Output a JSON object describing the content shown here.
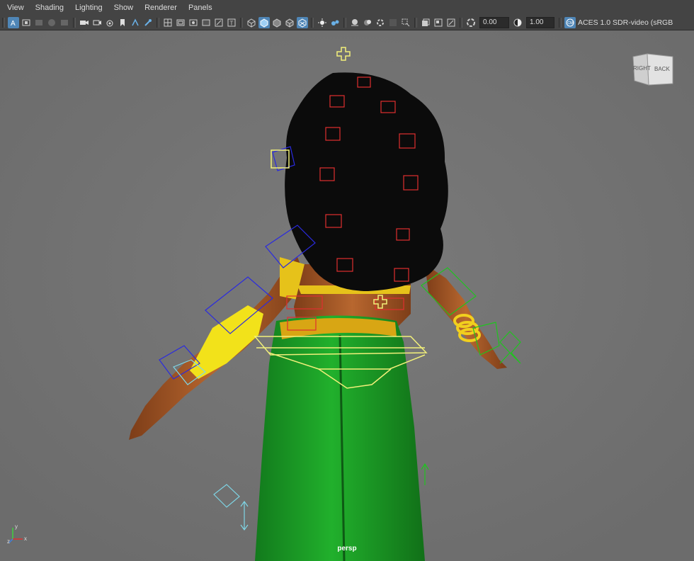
{
  "menu": {
    "view": "View",
    "shading": "Shading",
    "lighting": "Lighting",
    "show": "Show",
    "renderer": "Renderer",
    "panels": "Panels"
  },
  "toolbar": {
    "exposure_value": "0.00",
    "gamma_value": "1.00",
    "color_space_badge": "CM",
    "color_space_label": "ACES 1.0 SDR-video (sRGB",
    "accent_color": "#4f86b7",
    "icons": [
      "select-camera-icon",
      "camera-attributes-icon",
      "bookmark-icon",
      "image-plane-icon",
      "grid-icon",
      "film-gate-icon",
      "resolution-gate-icon",
      "gate-mask-icon",
      "field-chart-icon",
      "safe-action-icon",
      "safe-title-icon",
      "wireframe-icon",
      "smooth-shade-icon",
      "default-material-icon",
      "shaded-wireframe-icon",
      "textured-icon",
      "use-all-lights-icon",
      "shadows-icon",
      "screen-space-ao-icon",
      "motion-blur-icon",
      "multisample-aa-icon",
      "depth-of-field-icon",
      "isolate-select-icon",
      "xray-icon",
      "xray-active-icon",
      "xray-joints-icon",
      "backface-culling-icon",
      "exposure-icon",
      "gamma-icon",
      "color-management-icon"
    ]
  },
  "viewport": {
    "camera": "persp",
    "viewcube": {
      "right": "RIGHT",
      "back": "BACK"
    },
    "axis": {
      "y": "y",
      "x": "x",
      "z": "z"
    },
    "colors": {
      "background": "#777777",
      "hair": "#0b0b0b",
      "pants": "#1fa32a",
      "skin": "#a65a2a",
      "gold": "#e6c21a",
      "ctrl_red": "#e03030",
      "ctrl_blue": "#2a2ae0",
      "ctrl_green": "#1fc41f",
      "ctrl_yellow": "#f2f07a",
      "ctrl_cyan": "#7fd6e6"
    }
  }
}
